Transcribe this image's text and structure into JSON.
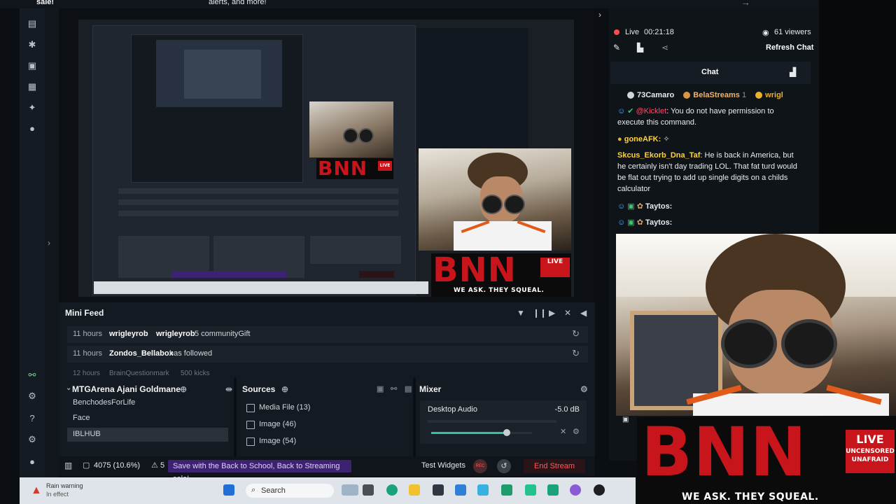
{
  "top": {
    "promo": "sale!",
    "alerts": "alerts, and more!"
  },
  "left_rail": {
    "icons": [
      "editor-icon",
      "themes-icon",
      "store-icon",
      "layout-icon",
      "highlighter-icon",
      "record-icon",
      "link-icon",
      "settings-gear-icon",
      "help-icon",
      "gear-icon",
      "profile-icon"
    ]
  },
  "stream": {
    "status": "Live",
    "timer": "00:21:18",
    "viewers": "61 viewers",
    "refresh_chat": "Refresh Chat"
  },
  "chat": {
    "title": "Chat",
    "badges": [
      {
        "count": "73Camaro",
        "badge": ""
      },
      {
        "count": "BelaStreams",
        "badge": "1"
      },
      {
        "count": "wrigl",
        "badge": ""
      }
    ],
    "messages": [
      {
        "user": "@Kicklet",
        "user_color": "#ff4d6a",
        "text": ": You do not have permission to execute this command."
      },
      {
        "user": "goneAFK:",
        "user_color": "#ffd23c",
        "text": ""
      },
      {
        "user": "Skcus_Ekorb_Dna_Taf",
        "user_color": "#ffd23c",
        "text": ": He is back in America, but he certainly isn't day trading LOL. That fat turd would be flat out trying to add up single digits on a childs calculator"
      },
      {
        "user": "Taytos:",
        "user_color": "#e8ecef",
        "text": ""
      },
      {
        "user": "Taytos:",
        "user_color": "#e8ecef",
        "text": ""
      }
    ]
  },
  "mini_feed": {
    "title": "Mini Feed",
    "rows": [
      {
        "time": "11 hours",
        "user": "wrigleyrob",
        "target": "wrigleyrob",
        "msg": "5 communityGift"
      },
      {
        "time": "11 hours",
        "user": "Zondos_Bellabox",
        "target": "",
        "msg": "has followed"
      }
    ],
    "partial_row": {
      "time": "12 hours",
      "user": "BrainQuestionmark",
      "msg": "500 kicks"
    }
  },
  "scenes": {
    "title": "MTGArena Ajani Goldmane",
    "items": [
      "BenchodesForLife",
      "Face",
      "IBLHUB"
    ]
  },
  "sources": {
    "title": "Sources",
    "items": [
      "Media File (13)",
      "Image (46)",
      "Image (54)"
    ]
  },
  "mixer": {
    "title": "Mixer",
    "channel": "Desktop Audio",
    "level": "-5.0 dB",
    "volume_fraction": 0.75
  },
  "footer": {
    "cpu": "4075 (10.6%)",
    "alerts_count": "5",
    "promo": "Save with the Back to School, Back to Streaming sale!",
    "test_widgets": "Test Widgets",
    "rec": "REC",
    "end_stream": "End Stream"
  },
  "taskbar": {
    "weather_title": "Rain warning",
    "weather_sub": "In effect",
    "search": "Search"
  },
  "bnn": {
    "logo": "BNN",
    "live": "LIVE",
    "uncensored": "UNCENSORED",
    "unafraid": "UNAFRAID",
    "tagline": "WE ASK. THEY SQUEAL."
  }
}
